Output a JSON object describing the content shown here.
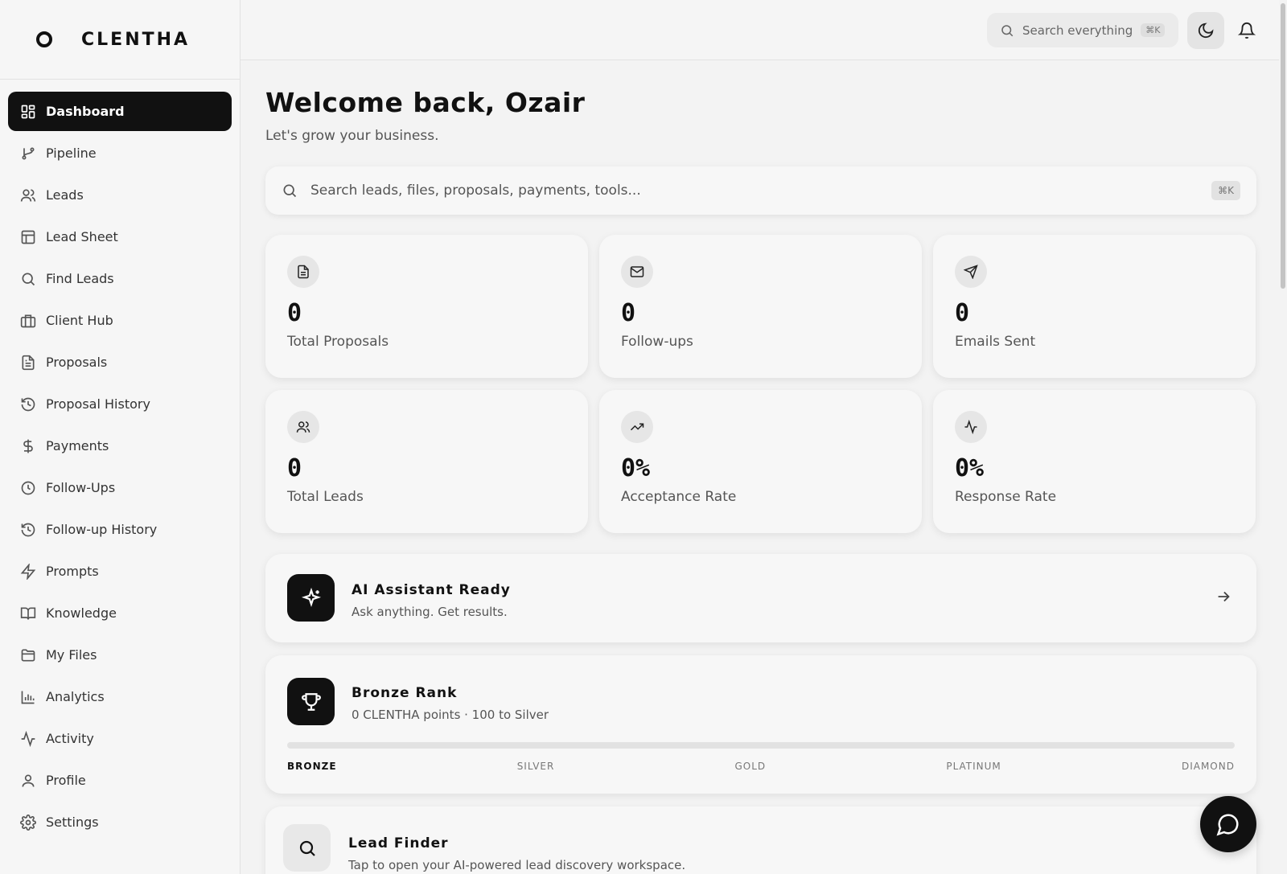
{
  "brand": {
    "name": "CLENTHA"
  },
  "sidebar": {
    "items": [
      {
        "label": "Dashboard",
        "icon": "grid-icon",
        "active": true
      },
      {
        "label": "Pipeline",
        "icon": "git-branch-icon"
      },
      {
        "label": "Leads",
        "icon": "users-icon"
      },
      {
        "label": "Lead Sheet",
        "icon": "table-icon"
      },
      {
        "label": "Find Leads",
        "icon": "search-icon"
      },
      {
        "label": "Client Hub",
        "icon": "briefcase-icon"
      },
      {
        "label": "Proposals",
        "icon": "file-text-icon"
      },
      {
        "label": "Proposal History",
        "icon": "history-icon"
      },
      {
        "label": "Payments",
        "icon": "dollar-icon"
      },
      {
        "label": "Follow-Ups",
        "icon": "clock-icon"
      },
      {
        "label": "Follow-up History",
        "icon": "history-icon"
      },
      {
        "label": "Prompts",
        "icon": "zap-icon"
      },
      {
        "label": "Knowledge",
        "icon": "book-icon"
      },
      {
        "label": "My Files",
        "icon": "folder-icon"
      },
      {
        "label": "Analytics",
        "icon": "bar-chart-icon"
      },
      {
        "label": "Activity",
        "icon": "activity-icon"
      },
      {
        "label": "Profile",
        "icon": "user-icon"
      },
      {
        "label": "Settings",
        "icon": "gear-icon"
      }
    ]
  },
  "topbar": {
    "search_placeholder": "Search everything",
    "search_shortcut": "⌘K"
  },
  "main": {
    "welcome": "Welcome back, Ozair",
    "subtitle": "Let's grow your business.",
    "search_placeholder": "Search leads, files, proposals, payments, tools...",
    "search_shortcut": "⌘K"
  },
  "stats": [
    {
      "value": "0",
      "label": "Total Proposals",
      "icon": "file-text-icon"
    },
    {
      "value": "0",
      "label": "Follow-ups",
      "icon": "mail-icon"
    },
    {
      "value": "0",
      "label": "Emails Sent",
      "icon": "send-icon"
    },
    {
      "value": "0",
      "label": "Total Leads",
      "icon": "users-icon"
    },
    {
      "value": "0%",
      "label": "Acceptance Rate",
      "icon": "trending-up-icon"
    },
    {
      "value": "0%",
      "label": "Response Rate",
      "icon": "activity-icon"
    }
  ],
  "ai_card": {
    "title": "AI Assistant Ready",
    "subtitle": "Ask anything. Get results."
  },
  "rank_card": {
    "title": "Bronze Rank",
    "subtitle": "0 CLENTHA points · 100 to Silver",
    "progress": 0,
    "tiers": [
      "BRONZE",
      "SILVER",
      "GOLD",
      "PLATINUM",
      "DIAMOND"
    ],
    "current_tier": "BRONZE"
  },
  "finder_card": {
    "title": "Lead Finder",
    "subtitle": "Tap to open your AI-powered lead discovery workspace."
  }
}
